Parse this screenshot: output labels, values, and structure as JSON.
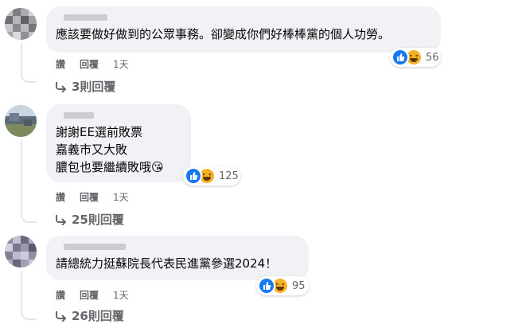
{
  "colors": {
    "bubble": "#f0f2f5",
    "secondary_text": "#65676b",
    "like_blue": "#1877f2",
    "haha_yellow": "#f7b125"
  },
  "comments": [
    {
      "text_lines": [
        "應該要做好做到的公眾事務。卻變成你們好棒棒黨的個人功勞。"
      ],
      "reactions": {
        "icons": [
          "like-icon",
          "haha-icon"
        ],
        "count": "56"
      },
      "actions": {
        "like": "讚",
        "reply": "回覆",
        "time": "1天"
      },
      "replies": "3則回覆"
    },
    {
      "text_lines": [
        "謝謝EE選前敗票",
        "嘉義市又大敗",
        "膿包也要繼續敗哦"
      ],
      "emoji": "😘",
      "reactions": {
        "icons": [
          "like-icon",
          "haha-icon"
        ],
        "count": "125"
      },
      "actions": {
        "like": "讚",
        "reply": "回覆",
        "time": "1天"
      },
      "replies": "25則回覆"
    },
    {
      "text_lines": [
        "請總統力挺蘇院長代表民進黨參選2024！"
      ],
      "reactions": {
        "icons": [
          "like-icon",
          "haha-icon"
        ],
        "count": "95"
      },
      "actions": {
        "like": "讚",
        "reply": "回覆",
        "time": "1天"
      },
      "replies": "26則回覆"
    }
  ]
}
